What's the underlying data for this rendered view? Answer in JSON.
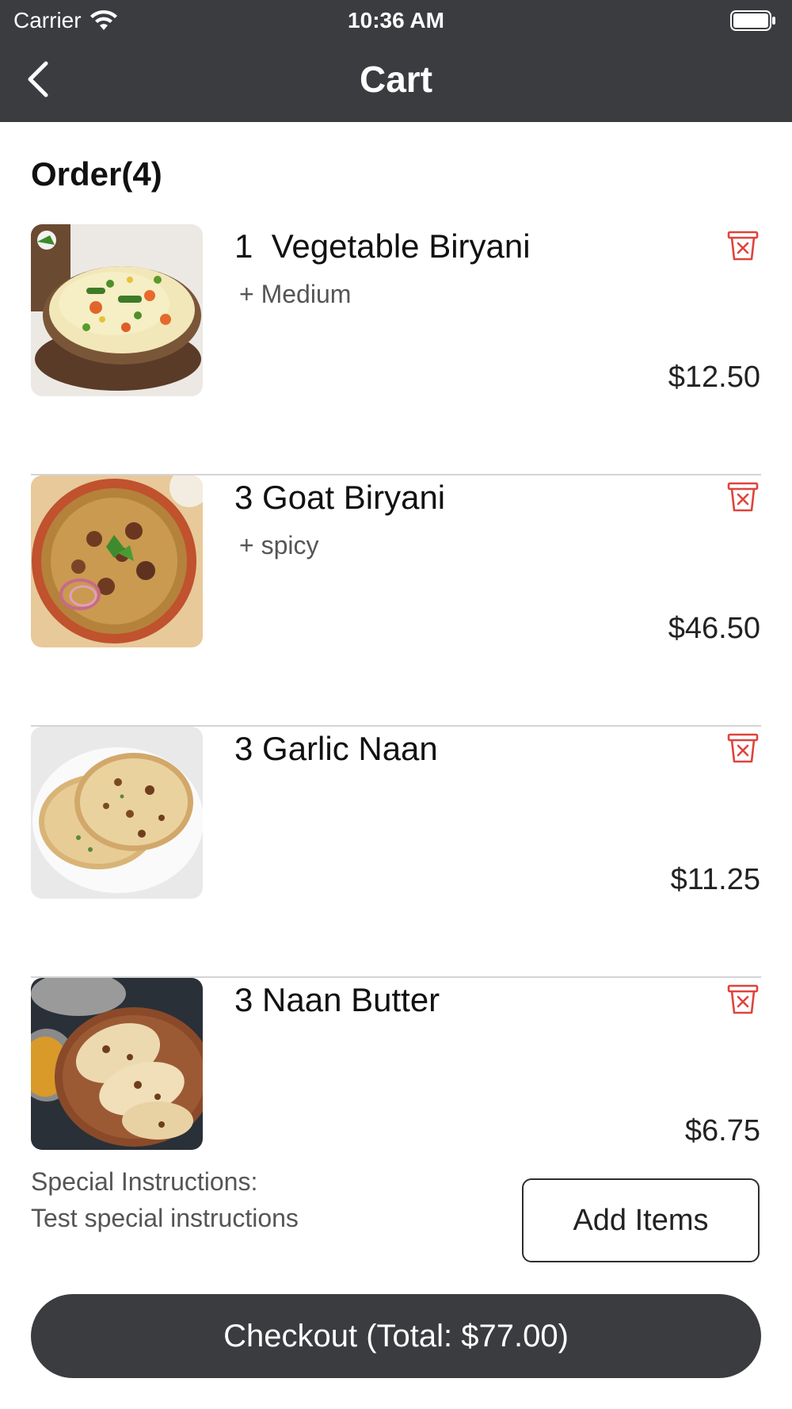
{
  "status_bar": {
    "carrier": "Carrier",
    "time": "10:36 AM"
  },
  "nav": {
    "title": "Cart"
  },
  "order": {
    "title": "Order(4)"
  },
  "items": [
    {
      "name": "1  Vegetable Biryani",
      "modifier": "+ Medium",
      "price": "$12.50"
    },
    {
      "name": "3 Goat Biryani",
      "modifier": "+ spicy",
      "price": "$46.50"
    },
    {
      "name": "3 Garlic Naan",
      "modifier": "",
      "price": "$11.25"
    },
    {
      "name": "3 Naan Butter",
      "modifier": "",
      "price": "$6.75"
    }
  ],
  "instructions": {
    "label": "Special Instructions:",
    "text": "Test special instructions"
  },
  "buttons": {
    "add_items": "Add Items",
    "checkout": "Checkout (Total: $77.00)"
  },
  "colors": {
    "header_bg": "#3b3c40",
    "delete_red": "#e0433b",
    "divider": "#d4d4d4"
  }
}
